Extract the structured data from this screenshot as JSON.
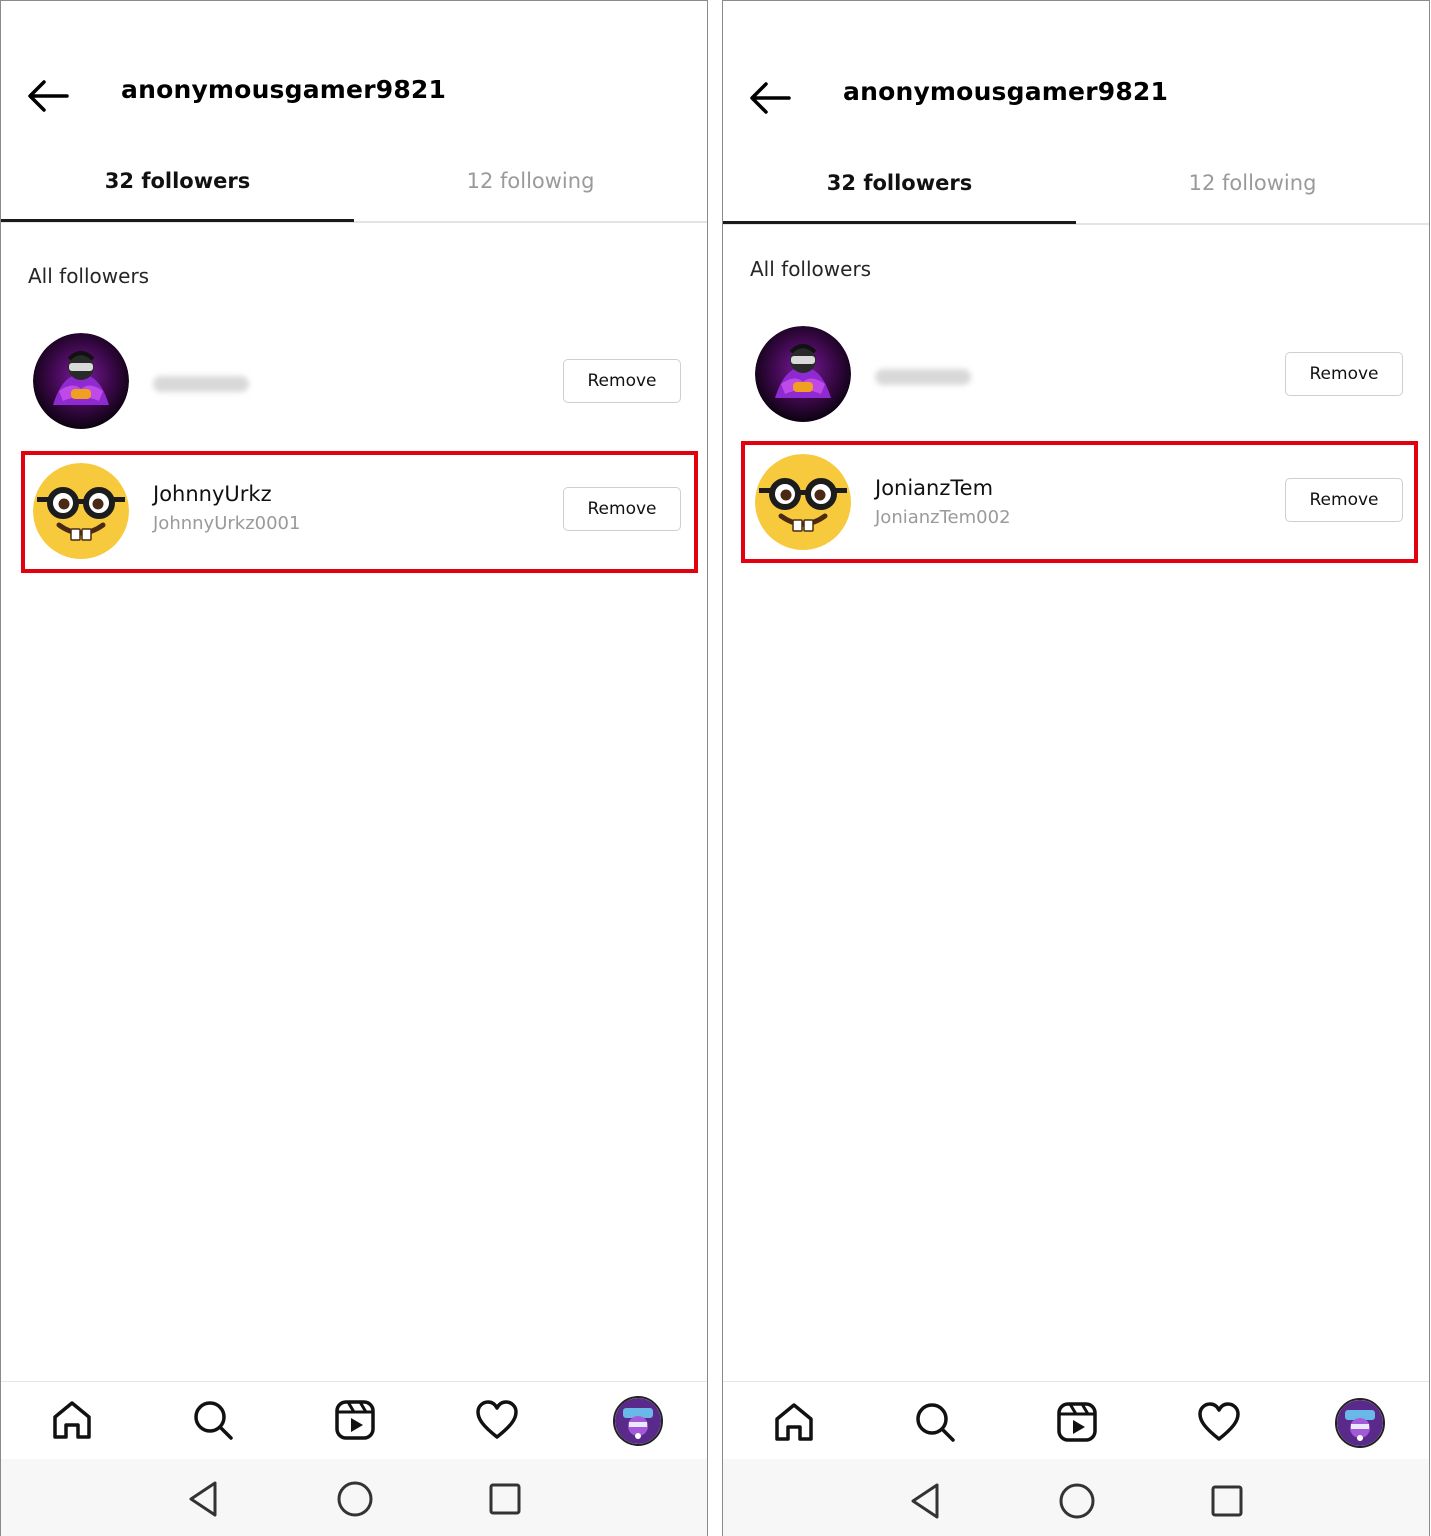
{
  "panels": [
    {
      "header": {
        "title": "anonymousgamer9821"
      },
      "tabs": {
        "followers": "32 followers",
        "following": "12 following"
      },
      "section_label": "All followers",
      "followers": [
        {
          "name": "",
          "handle": "",
          "name_blurred": true,
          "remove_label": "Remove",
          "avatar": "gamer-avatar"
        },
        {
          "name": "JohnnyUrkz",
          "handle": "JohnnyUrkz0001",
          "name_blurred": false,
          "remove_label": "Remove",
          "avatar": "nerd-face-emoji",
          "highlighted": true
        }
      ],
      "bottom_nav": [
        "home-icon",
        "search-icon",
        "reels-icon",
        "heart-icon",
        "profile-avatar"
      ],
      "system_nav": [
        "back-triangle-icon",
        "home-circle-icon",
        "recents-square-icon"
      ]
    },
    {
      "header": {
        "title": "anonymousgamer9821"
      },
      "tabs": {
        "followers": "32 followers",
        "following": "12 following"
      },
      "section_label": "All followers",
      "followers": [
        {
          "name": "",
          "handle": "",
          "name_blurred": true,
          "remove_label": "Remove",
          "avatar": "gamer-avatar"
        },
        {
          "name": "JonianzTem",
          "handle": "JonianzTem002",
          "name_blurred": false,
          "remove_label": "Remove",
          "avatar": "nerd-face-emoji",
          "highlighted": true
        }
      ],
      "bottom_nav": [
        "home-icon",
        "search-icon",
        "reels-icon",
        "heart-icon",
        "profile-avatar"
      ],
      "system_nav": [
        "back-triangle-icon",
        "home-circle-icon",
        "recents-square-icon"
      ]
    }
  ],
  "colors": {
    "highlight": "#e3000f",
    "active_tab": "#1a1a1a",
    "inactive_text": "#9a9a9a"
  }
}
